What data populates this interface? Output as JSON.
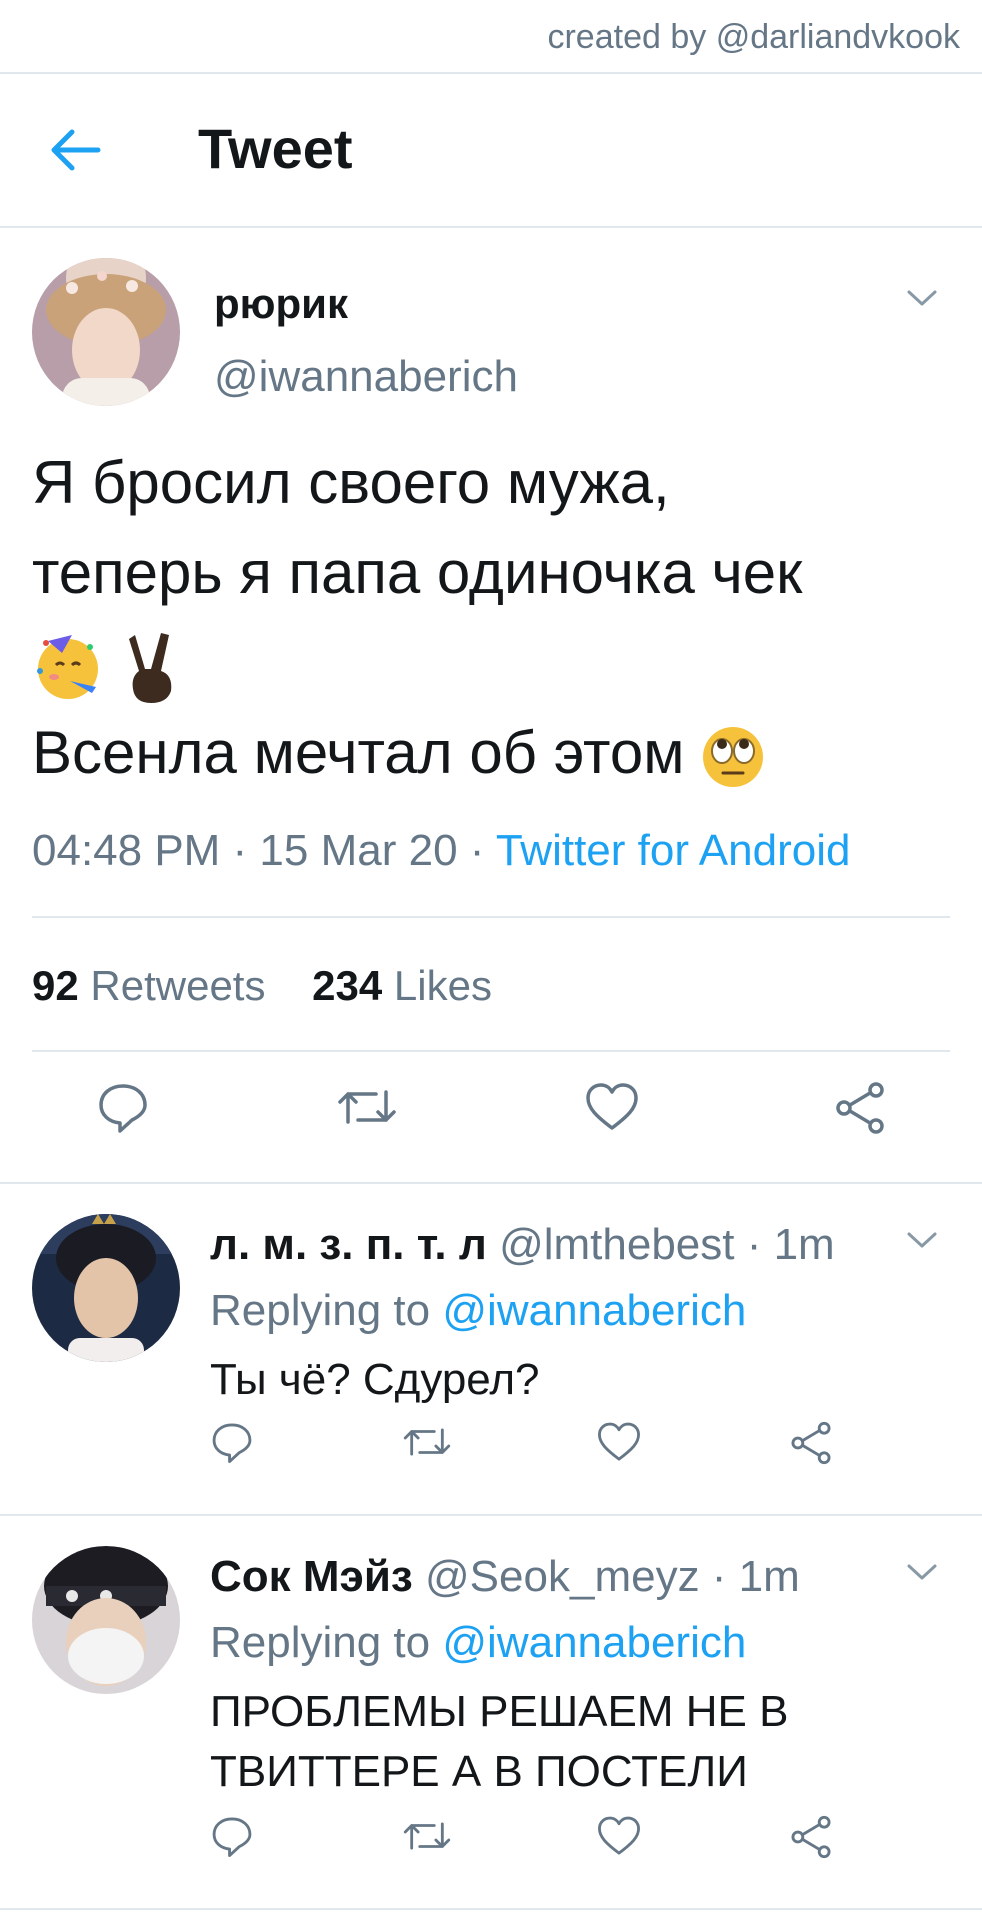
{
  "credit": "created by @darliandvkook",
  "header": {
    "title": "Tweet"
  },
  "tweet": {
    "name": "рюрик",
    "handle": "@iwannaberich",
    "line1": "Я бросил своего мужа,",
    "line2": "теперь я папа одиночка чек",
    "line4": "Всенла мечтал об этом",
    "time": "04:48 PM · 15 Mar 20 · ",
    "source": "Twitter for Android",
    "retweets_count": "92",
    "retweets_label": "Retweets",
    "likes_count": "234",
    "likes_label": "Likes"
  },
  "replies": [
    {
      "name": "л. м. з. п. т. л",
      "meta": "@lmthebest · 1m",
      "replying_label": "Replying to",
      "replying_handle": "@iwannaberich",
      "text": "Ты чё? Сдурел?"
    },
    {
      "name": "Сок Мэйз",
      "meta": "@Seok_meyz · 1m",
      "replying_label": "Replying to",
      "replying_handle": "@iwannaberich",
      "text_line1": "ПРОБЛЕМЫ РЕШАЕМ НЕ В",
      "text_line2": "ТВИТТЕРЕ А В ПОСТЕЛИ"
    }
  ],
  "icons": {
    "back": "arrow-left-icon",
    "menu": "chevron-down-icon",
    "reply": "speech-bubble-icon",
    "retweet": "retweet-icon",
    "like": "heart-icon",
    "share": "share-icon"
  },
  "colors": {
    "accent": "#1da1f2",
    "secondary_text": "#657786",
    "divider": "#e1e8ed"
  }
}
